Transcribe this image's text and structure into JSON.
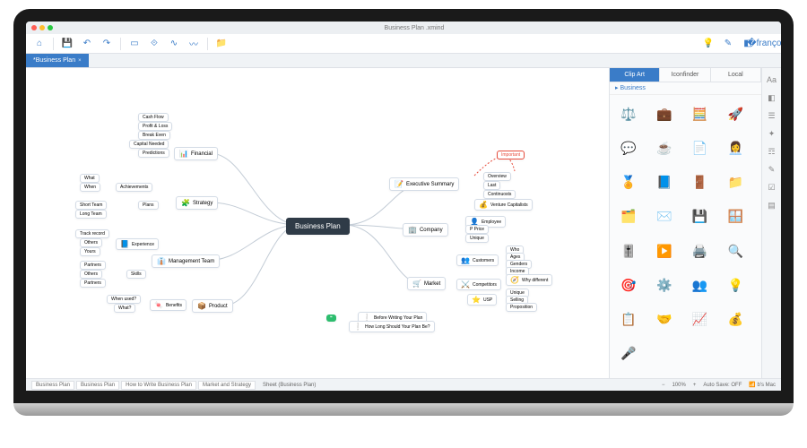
{
  "window": {
    "title": "Business Plan .xmind"
  },
  "document_tab": {
    "label": "*Business Plan"
  },
  "toolbar_icons": [
    "home",
    "save",
    "undo",
    "redo",
    "topic",
    "subtopic",
    "relationship",
    "boundary",
    "summary",
    "folder",
    "idea",
    "style",
    "marker",
    "share"
  ],
  "center_node": "Business Plan",
  "branches": {
    "executive_summary": {
      "label": "Executive Summary",
      "items": [
        "Overview",
        "Last",
        "Continuosts",
        "Venture Capitalists"
      ],
      "callout": "Important"
    },
    "financial": {
      "label": "Financial",
      "items": [
        "Cash Flow",
        "Profit & Loss",
        "Break Even",
        "Capital Needed",
        "Predictions"
      ]
    },
    "strategy": {
      "label": "Strategy",
      "plans": {
        "label": "Plans",
        "items": [
          "What",
          "When",
          "Short Team",
          "Long Team"
        ]
      },
      "achievements": "Achievements"
    },
    "management": {
      "label": "Management Team",
      "experience": {
        "label": "Experience",
        "items": [
          "Track record",
          "Others",
          "Yours"
        ]
      },
      "skills": {
        "label": "Skills",
        "items": [
          "Partners",
          "Others",
          "Partners"
        ]
      }
    },
    "product": {
      "label": "Product",
      "benefits": {
        "label": "Benefits",
        "items": [
          "When used?",
          "What?"
        ]
      }
    },
    "company": {
      "label": "Company",
      "items": [
        "Employee",
        "P Price",
        "Unique"
      ]
    },
    "market": {
      "label": "Market",
      "customers": {
        "label": "Customers",
        "items": [
          "Who",
          "Ages",
          "Genders",
          "Income",
          "Why different"
        ]
      },
      "competitors": "Competitors",
      "usp": {
        "label": "USP",
        "items": [
          "Unique",
          "Selling",
          "Proposition"
        ]
      },
      "writing": [
        "Before Writing Your Plan",
        "How Long Should Your Plan Be?"
      ]
    }
  },
  "side_panel": {
    "tabs": [
      {
        "label": "Clip Art",
        "active": true
      },
      {
        "label": "Iconfinder",
        "active": false
      },
      {
        "label": "Local",
        "active": false
      }
    ],
    "category": "Business",
    "icons": [
      "scales",
      "briefcase",
      "calculator",
      "rocket",
      "chat",
      "coffee",
      "doc",
      "headset",
      "ribbon",
      "book",
      "garage",
      "folder-o",
      "folder-b",
      "mail",
      "card",
      "window",
      "slider",
      "play",
      "printer",
      "search",
      "target",
      "gear",
      "people",
      "idea",
      "form",
      "deal",
      "chart",
      "coin",
      "mic",
      "empty"
    ]
  },
  "rail_icons": [
    "format",
    "marker",
    "outline",
    "clipart",
    "tree",
    "note",
    "task",
    "sheet"
  ],
  "status": {
    "sheets": [
      "Business Plan",
      "Business Plan",
      "How to Write Business Plan",
      "Market and Strategy"
    ],
    "sheet_label": "Sheet (Business Plan)",
    "zoom": "100%",
    "auto_save": "Auto Save: OFF",
    "user": "b's Mac"
  },
  "icon_glyphs": {
    "scales": "⚖️",
    "briefcase": "💼",
    "calculator": "🧮",
    "rocket": "🚀",
    "chat": "💬",
    "coffee": "☕",
    "doc": "📄",
    "headset": "👩‍💼",
    "ribbon": "🏅",
    "book": "📘",
    "garage": "🚪",
    "folder-o": "📁",
    "folder-b": "🗂️",
    "mail": "✉️",
    "card": "💾",
    "window": "🪟",
    "slider": "🎚️",
    "play": "▶️",
    "printer": "🖨️",
    "search": "🔍",
    "target": "🎯",
    "gear": "⚙️",
    "people": "👥",
    "idea": "💡",
    "form": "📋",
    "deal": "🤝",
    "chart": "📈",
    "coin": "💰",
    "mic": "🎤",
    "empty": " "
  }
}
